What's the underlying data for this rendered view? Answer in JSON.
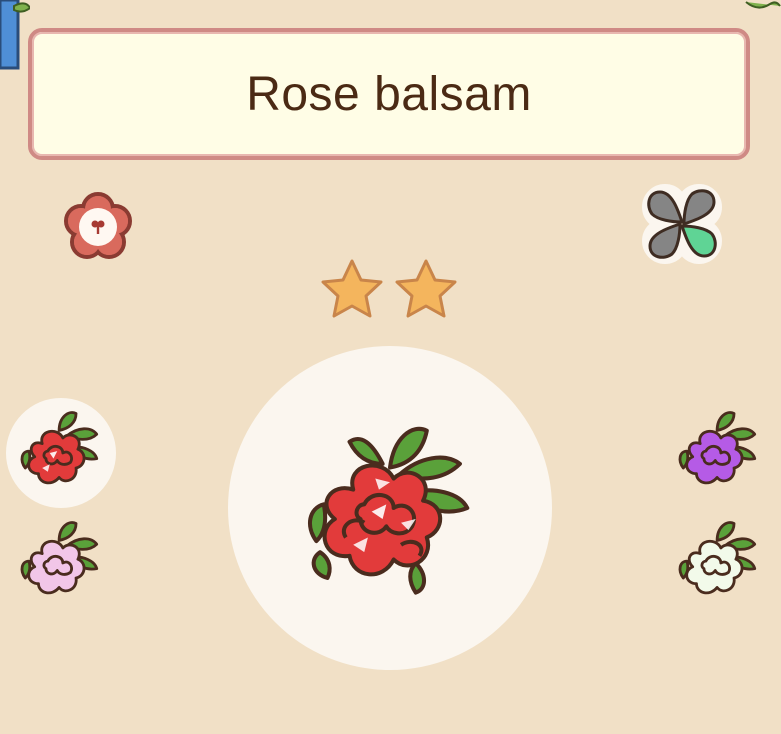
{
  "title": "Rose balsam",
  "rating": {
    "stars": 2
  },
  "colors": {
    "background": "#f1e0c6",
    "card_fill": "#fffde6",
    "card_border": "#cf8a85",
    "title_text": "#4b2a14",
    "star": "#f4b55d",
    "leaf": "#5aa13a",
    "outline": "#4a2c1e"
  },
  "icons": {
    "top_left": "flower-badge-icon",
    "top_right": "clover-icon"
  },
  "variants": [
    {
      "name": "red",
      "color": "#e23b3b",
      "selected": true
    },
    {
      "name": "pink",
      "color": "#f2c6e8",
      "selected": false
    },
    {
      "name": "purple",
      "color": "#b55be6",
      "selected": false
    },
    {
      "name": "white",
      "color": "#f2faea",
      "selected": false
    }
  ],
  "main_flower": {
    "name": "red",
    "color": "#e23b3b"
  }
}
